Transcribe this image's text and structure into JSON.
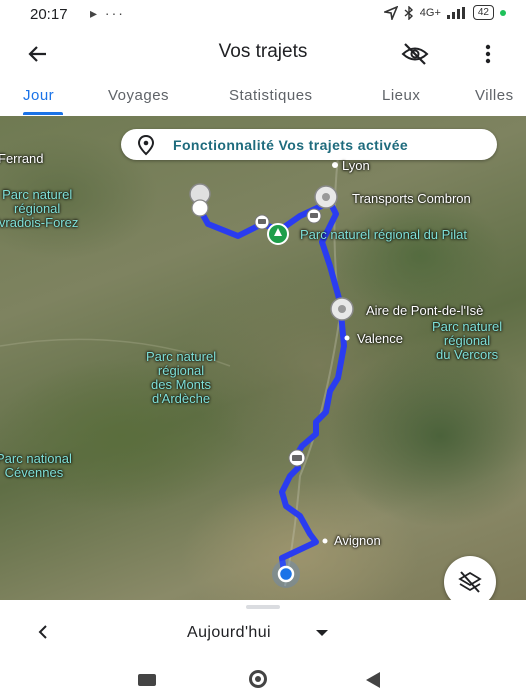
{
  "status_bar": {
    "time": "20:17",
    "extra": "▸ ···",
    "network": "4G+",
    "battery": "42"
  },
  "app_bar": {
    "title": "Vos trajets"
  },
  "tabs": [
    {
      "label": "Jour",
      "active": true
    },
    {
      "label": "Voyages",
      "active": false
    },
    {
      "label": "Statistiques",
      "active": false
    },
    {
      "label": "Lieux",
      "active": false
    },
    {
      "label": "Villes",
      "active": false
    }
  ],
  "map": {
    "banner": "Fonctionnalité Vos trajets activée",
    "labels": {
      "ferrand": "Ferrand",
      "lyon": "Lyon",
      "transports": "Transports Combron",
      "pnr_livradois": "Parc naturel\nrégional\nivradois-Forez",
      "pnr_pilat": "Parc naturel régional du Pilat",
      "aire": "Aire de Pont-de-l'Isè",
      "valence": "Valence",
      "pnr_vercors": "Parc naturel\nrégional\ndu Vercors",
      "pnr_ardeche": "Parc naturel\nrégional\ndes Monts\nd'Ardèche",
      "pn_cevennes": "Parc national\nCévennes",
      "avignon": "Avignon"
    },
    "route_color": "#2a3cf0"
  },
  "bottom_sheet": {
    "date_label": "Aujourd'hui"
  }
}
